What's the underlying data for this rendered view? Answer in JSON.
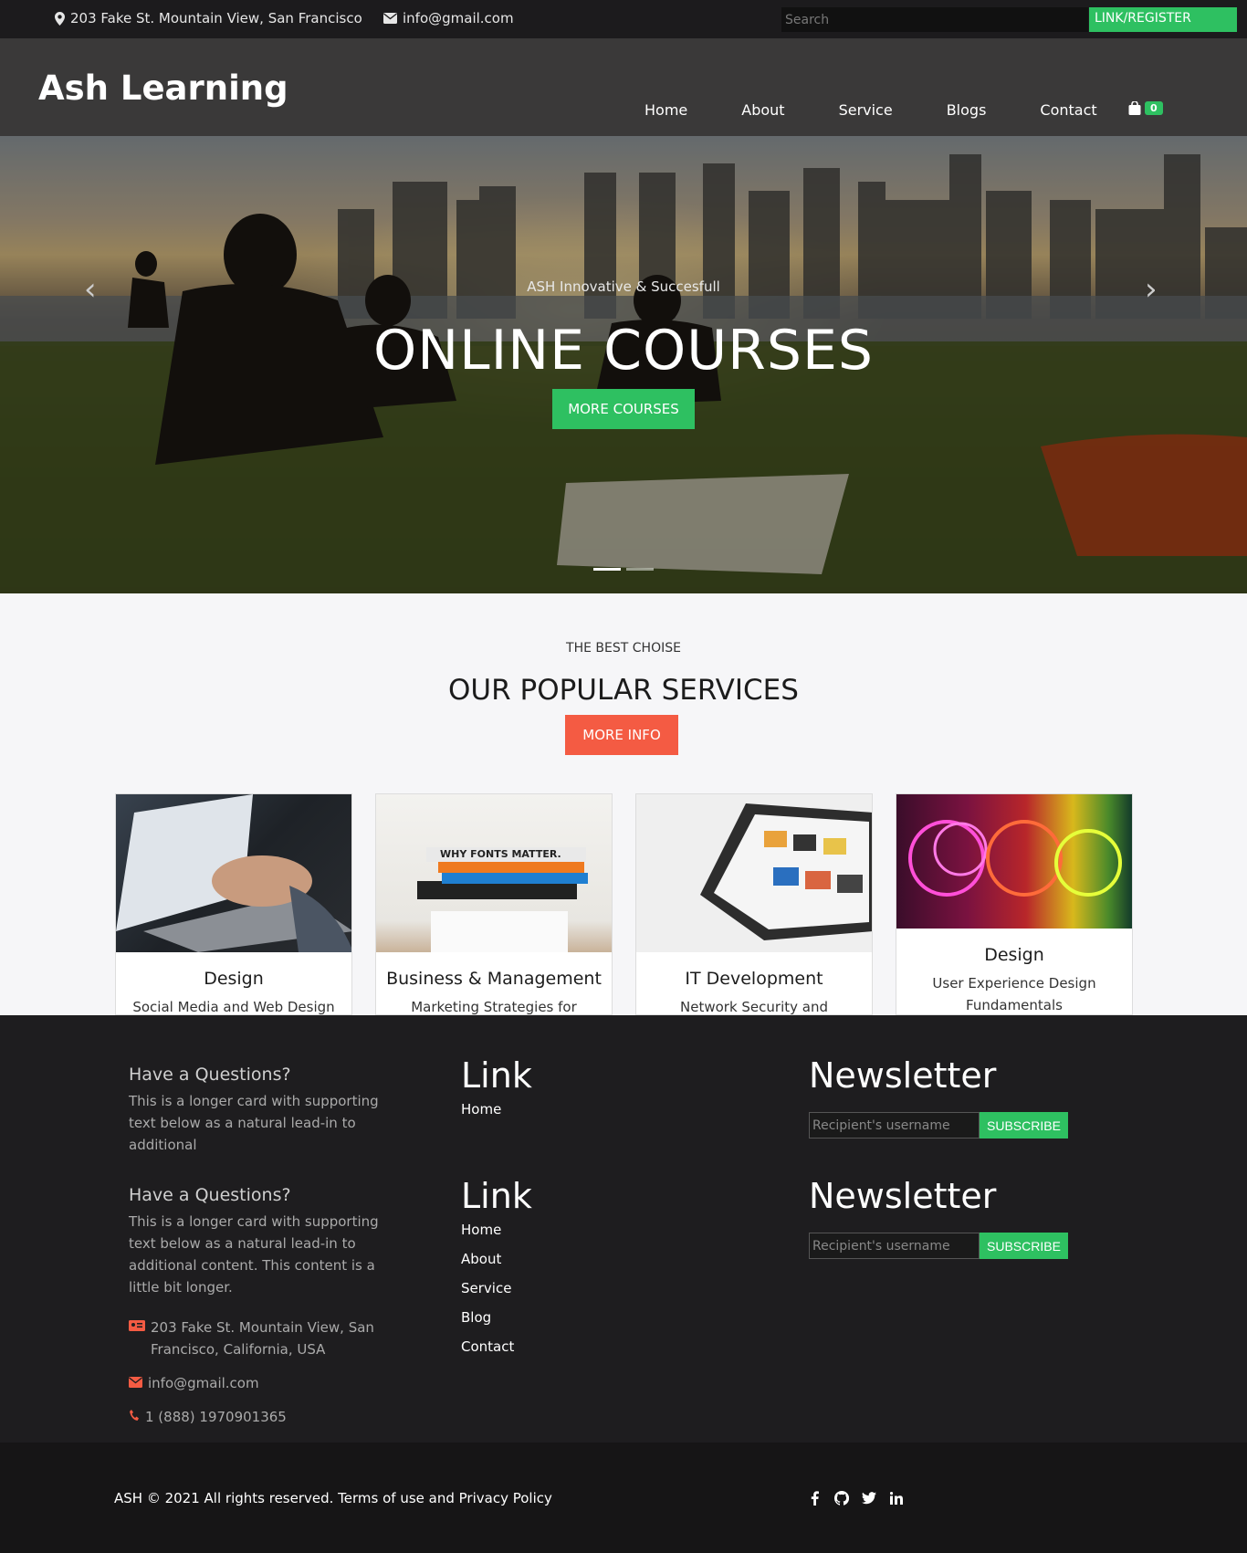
{
  "topbar": {
    "address": "203 Fake St. Mountain View, San Francisco",
    "email": "info@gmail.com",
    "search_placeholder": "Search",
    "login_label": "LINK/REGISTER"
  },
  "header": {
    "brand": "Ash Learning",
    "nav": [
      "Home",
      "About",
      "Service",
      "Blogs",
      "Contact"
    ],
    "cart_count": "0"
  },
  "hero": {
    "kicker": "ASH Innovative & Succesfull",
    "title": "ONLINE COURSES",
    "cta_label": "MORE COURSES",
    "prev_label": "‹",
    "next_label": "›"
  },
  "services": {
    "kicker": "THE BEST CHOISE",
    "title": "OUR POPULAR SERVICES",
    "more_label": "MORE INFO",
    "cards": [
      {
        "title": "Design",
        "text": "Social Media and Web Design"
      },
      {
        "title": "Business & Management",
        "text": "Marketing Strategies for"
      },
      {
        "title": "IT Development",
        "text": "Network Security and"
      },
      {
        "title": "Design",
        "text": "User Experience Design Fundamentals"
      }
    ]
  },
  "footer": {
    "q1_title": "Have a Questions?",
    "q1_text": "This is a longer card with supporting text below as a natural lead-in to additional",
    "q2_title": "Have a Questions?",
    "q2_text": "This is a longer card with supporting text below as a natural lead-in to additional content. This content is a little bit longer.",
    "address": "203 Fake St. Mountain View, San Francisco, California, USA",
    "email": "info@gmail.com",
    "phone": "1 (888) 1970901365",
    "link1_title": "Link",
    "link1_items": [
      "Home"
    ],
    "link2_title": "Link",
    "link2_items": [
      "Home",
      "About",
      "Service",
      "Blog",
      "Contact"
    ],
    "news1_title": "Newsletter",
    "news2_title": "Newsletter",
    "news_placeholder": "Recipient's username",
    "subscribe_label": "SUBSCRIBE"
  },
  "bottom": {
    "copyright": "ASH © 2021 All rights reserved. Terms of use and Privacy Policy"
  },
  "colors": {
    "green": "#2ec061",
    "coral": "#f45b43",
    "dark": "#1e1d1f"
  }
}
